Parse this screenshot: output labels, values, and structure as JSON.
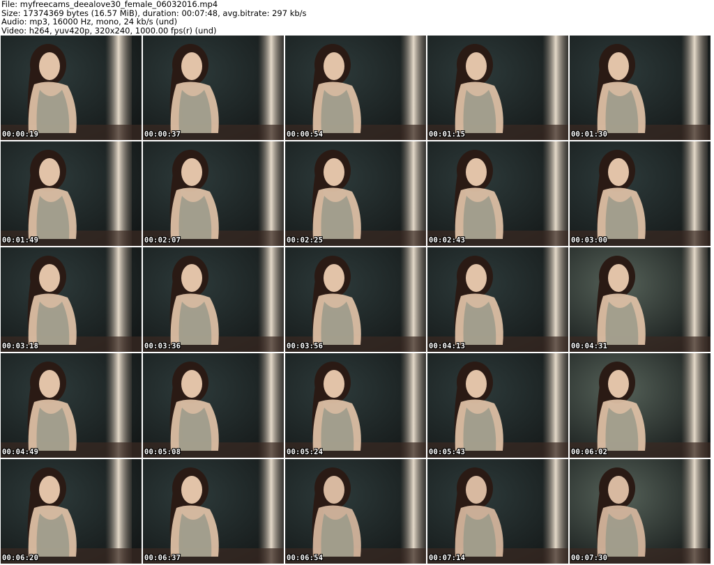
{
  "header": {
    "file_line": "File: myfreecams_deealove30_female_06032016.mp4",
    "size_line": "Size: 17374369 bytes (16.57 MiB), duration: 00:07:48, avg.bitrate: 297 kb/s",
    "audio_line": "Audio: mp3, 16000 Hz, mono, 24 kb/s (und)",
    "video_line": "Video: h264, yuv420p, 320x240, 1000.00 fps(r) (und)"
  },
  "colors": {
    "background": "#ffffff",
    "header_text": "#000000",
    "timestamp_text": "#ffffff",
    "timestamp_outline": "#000000"
  },
  "thumbnails": [
    {
      "timestamp": "00:00:19"
    },
    {
      "timestamp": "00:00:37"
    },
    {
      "timestamp": "00:00:54"
    },
    {
      "timestamp": "00:01:15"
    },
    {
      "timestamp": "00:01:30"
    },
    {
      "timestamp": "00:01:49"
    },
    {
      "timestamp": "00:02:07"
    },
    {
      "timestamp": "00:02:25"
    },
    {
      "timestamp": "00:02:43"
    },
    {
      "timestamp": "00:03:00"
    },
    {
      "timestamp": "00:03:18"
    },
    {
      "timestamp": "00:03:36"
    },
    {
      "timestamp": "00:03:56"
    },
    {
      "timestamp": "00:04:13"
    },
    {
      "timestamp": "00:04:31"
    },
    {
      "timestamp": "00:04:49"
    },
    {
      "timestamp": "00:05:08"
    },
    {
      "timestamp": "00:05:24"
    },
    {
      "timestamp": "00:05:43"
    },
    {
      "timestamp": "00:06:02"
    },
    {
      "timestamp": "00:06:20"
    },
    {
      "timestamp": "00:06:37"
    },
    {
      "timestamp": "00:06:54"
    },
    {
      "timestamp": "00:07:14"
    },
    {
      "timestamp": "00:07:30"
    }
  ]
}
